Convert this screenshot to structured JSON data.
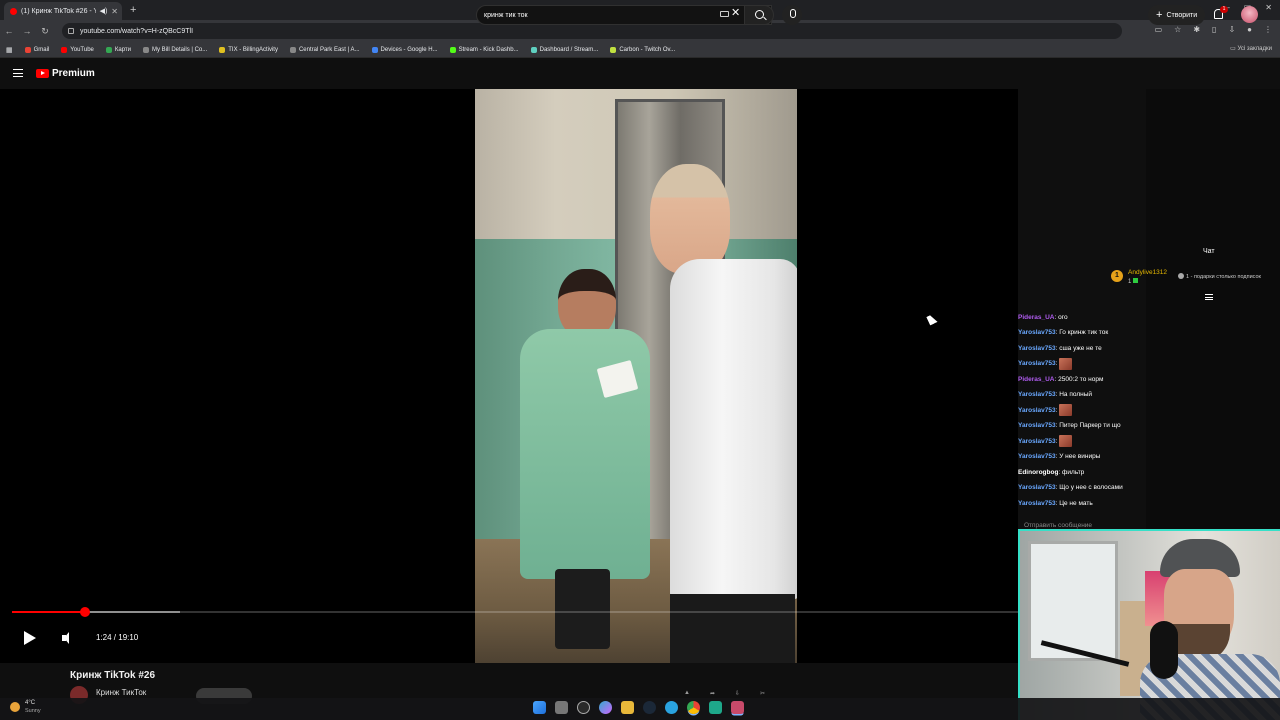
{
  "browser": {
    "tab_title": "(1) Кринж TikTok #26 - YouTube",
    "url": "youtube.com/watch?v=H-zQBcC9TlI",
    "bookmarks": [
      "Gmail",
      "YouTube",
      "Карти",
      "My Bill Details | Co...",
      "TIX - BillingActivity",
      "Central Park East | A...",
      "Devices - Google H...",
      "Stream - Kick Dashb...",
      "Dashboard / Stream...",
      "Carbon - Twitch Ov..."
    ],
    "all_bookmarks": "Усі закладки"
  },
  "youtube": {
    "brand": "Premium",
    "search_query": "кринж тик ток",
    "create_label": "Створити",
    "notification_count": "1"
  },
  "player": {
    "time": "1:24 / 19:10",
    "progress": 0.073,
    "buffered": 0.167
  },
  "video": {
    "title": "Кринж TikTok #26",
    "channel": "Кринж ТикТок"
  },
  "chat": {
    "title": "Чат",
    "gift": {
      "user": "Andylive1312",
      "count": "1",
      "note": "1 - подарки столько подписок"
    },
    "messages": [
      {
        "user": "Pideras_UA",
        "color": "#b05cf0",
        "text": ": ого",
        "emote": false
      },
      {
        "user": "Yaroslav753",
        "color": "#6aa8ff",
        "text": ": Го кринж тик ток",
        "emote": false
      },
      {
        "user": "Yaroslav753",
        "color": "#6aa8ff",
        "text": ": сша уже не те",
        "emote": false
      },
      {
        "user": "Yaroslav753",
        "color": "#6aa8ff",
        "text": ":",
        "emote": true
      },
      {
        "user": "Pideras_UA",
        "color": "#b05cf0",
        "text": ": 2500:2 то норм",
        "emote": false
      },
      {
        "user": "Yaroslav753",
        "color": "#6aa8ff",
        "text": ": На полный",
        "emote": false
      },
      {
        "user": "Yaroslav753",
        "color": "#6aa8ff",
        "text": ":",
        "emote": true
      },
      {
        "user": "Yaroslav753",
        "color": "#6aa8ff",
        "text": ": Питер Паркер ти що",
        "emote": false
      },
      {
        "user": "Yaroslav753",
        "color": "#6aa8ff",
        "text": ":",
        "emote": true
      },
      {
        "user": "Yaroslav753",
        "color": "#6aa8ff",
        "text": ": У нее виниры",
        "emote": false
      },
      {
        "user": "Edinorogbog",
        "color": "#ffffff",
        "text": ": фильтр",
        "emote": false
      },
      {
        "user": "Yaroslav753",
        "color": "#6aa8ff",
        "text": ": Що у нее с волосами",
        "emote": false
      },
      {
        "user": "Yaroslav753",
        "color": "#6aa8ff",
        "text": ": Це не мать",
        "emote": false
      }
    ],
    "input_placeholder": "Отправить сообщение"
  },
  "taskbar": {
    "temp": "4°C",
    "condition": "Sunny"
  },
  "colors": {
    "youtube_red": "#ff0000",
    "chat_user_blue": "#6aa8ff",
    "chat_user_purple": "#b05cf0",
    "gift_gold": "#e6b800"
  }
}
